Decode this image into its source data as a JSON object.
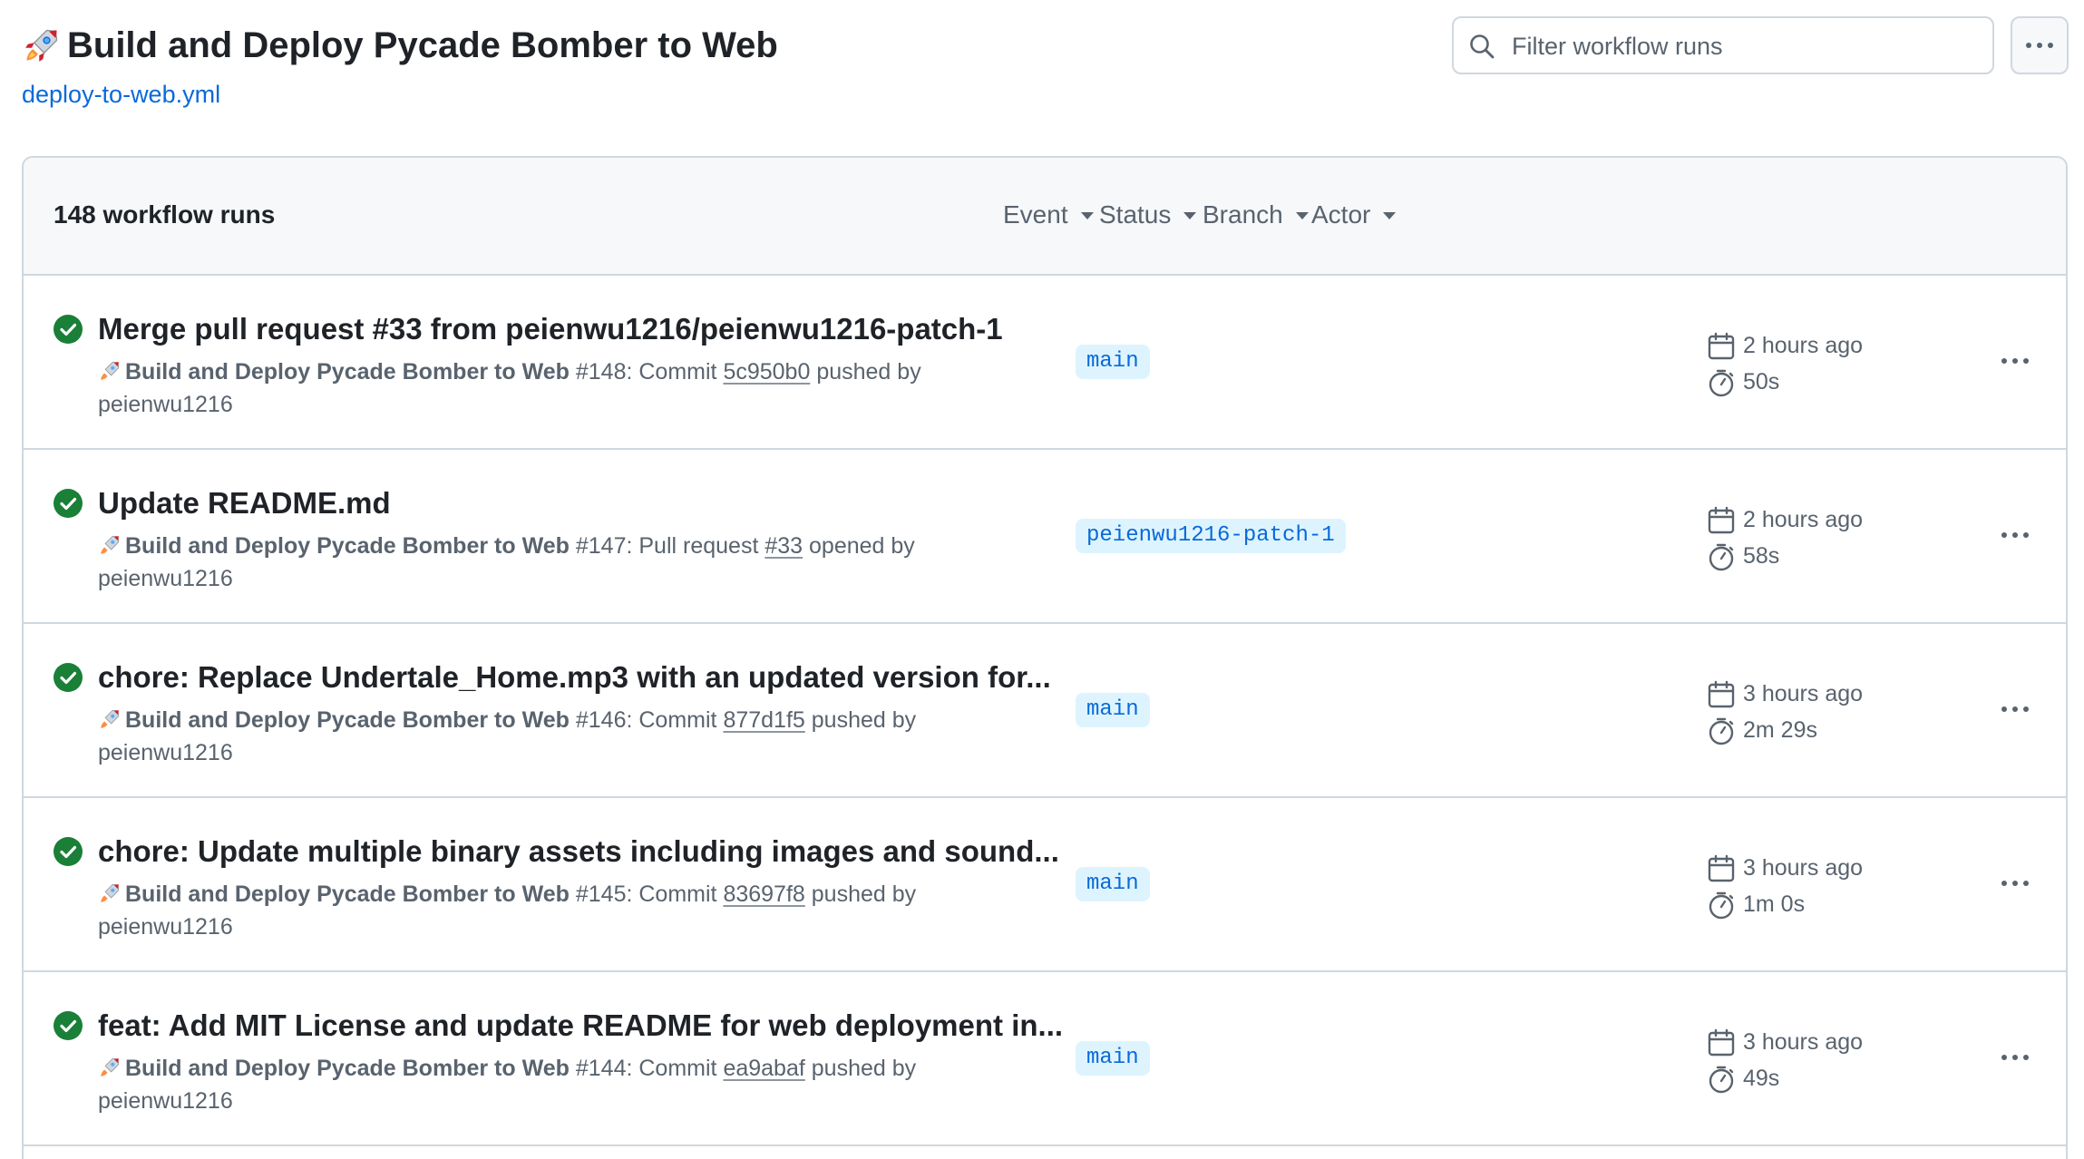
{
  "workflow": {
    "title": "Build and Deploy Pycade Bomber to Web",
    "file": "deploy-to-web.yml"
  },
  "search": {
    "placeholder": "Filter workflow runs"
  },
  "list": {
    "count_label": "148 workflow runs",
    "filters": [
      "Event",
      "Status",
      "Branch",
      "Actor"
    ]
  },
  "runs": [
    {
      "title": "Merge pull request #33 from peienwu1216/peienwu1216-patch-1",
      "workflow": "Build and Deploy Pycade Bomber to Web",
      "number": "#148",
      "event_prefix": ": Commit ",
      "ref": "5c950b0",
      "event_suffix": " pushed by",
      "actor": "peienwu1216",
      "branch": "main",
      "ago": "2 hours ago",
      "duration": "50s",
      "status": "success"
    },
    {
      "title": "Update README.md",
      "workflow": "Build and Deploy Pycade Bomber to Web",
      "number": "#147",
      "event_prefix": ": Pull request ",
      "ref": "#33",
      "event_suffix": " opened by",
      "actor": "peienwu1216",
      "branch": "peienwu1216-patch-1",
      "ago": "2 hours ago",
      "duration": "58s",
      "status": "success"
    },
    {
      "title": "chore: Replace Undertale_Home.mp3 with an updated version for...",
      "workflow": "Build and Deploy Pycade Bomber to Web",
      "number": "#146",
      "event_prefix": ": Commit ",
      "ref": "877d1f5",
      "event_suffix": " pushed by",
      "actor": "peienwu1216",
      "branch": "main",
      "ago": "3 hours ago",
      "duration": "2m 29s",
      "status": "success"
    },
    {
      "title": "chore: Update multiple binary assets including images and sound...",
      "workflow": "Build and Deploy Pycade Bomber to Web",
      "number": "#145",
      "event_prefix": ": Commit ",
      "ref": "83697f8",
      "event_suffix": " pushed by",
      "actor": "peienwu1216",
      "branch": "main",
      "ago": "3 hours ago",
      "duration": "1m 0s",
      "status": "success"
    },
    {
      "title": "feat: Add MIT License and update README for web deployment in...",
      "workflow": "Build and Deploy Pycade Bomber to Web",
      "number": "#144",
      "event_prefix": ": Commit ",
      "ref": "ea9abaf",
      "event_suffix": " pushed by",
      "actor": "peienwu1216",
      "branch": "main",
      "ago": "3 hours ago",
      "duration": "49s",
      "status": "success"
    }
  ],
  "icons": {
    "title": "rocket-icon",
    "search": "search-icon",
    "status": "check-circle-fill-icon",
    "date": "calendar-icon",
    "duration": "stopwatch-icon",
    "menu": "kebab-horizontal-icon"
  },
  "colors": {
    "success": "#1a7f37",
    "link": "#0969da",
    "branch_bg": "#ddf4ff",
    "muted": "#59636e",
    "border": "#d0d7de"
  }
}
